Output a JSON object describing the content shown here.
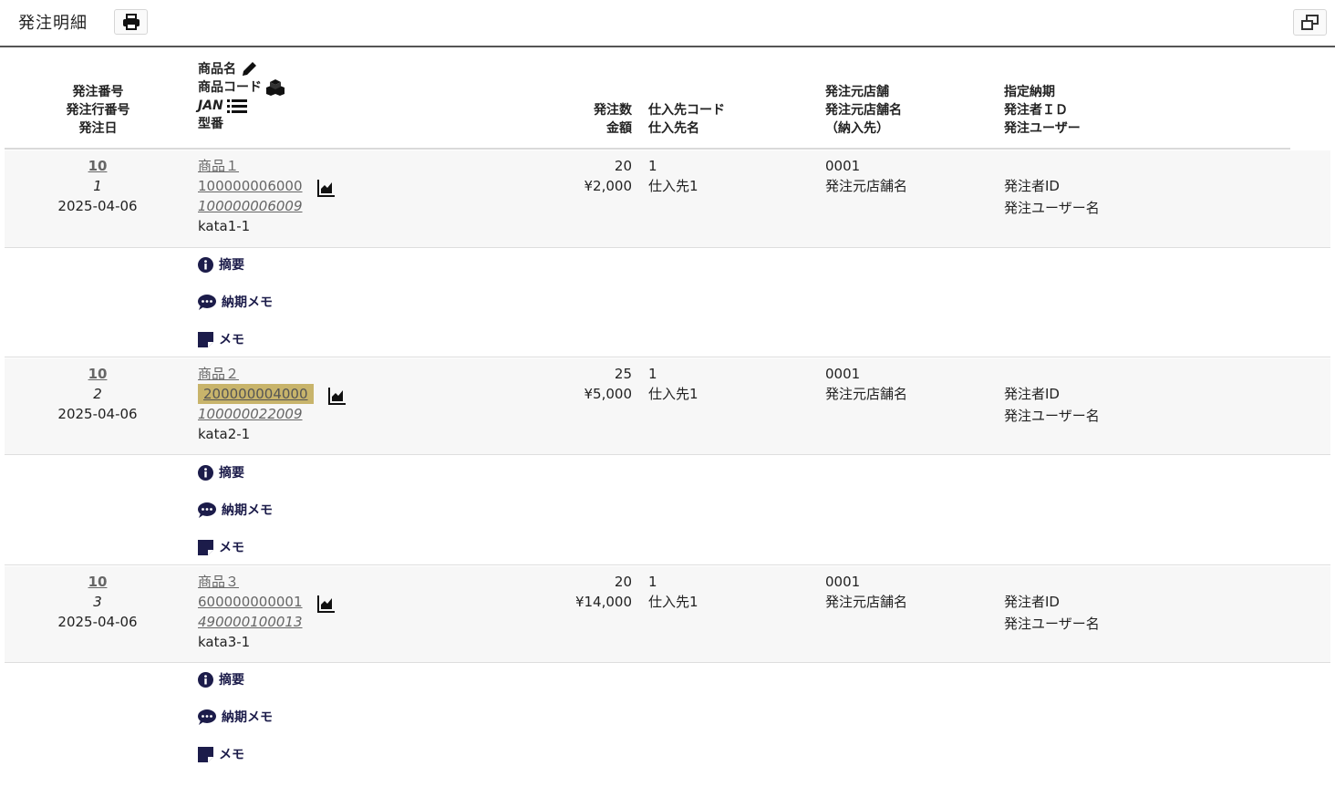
{
  "header": {
    "title": "発注明細"
  },
  "columns": {
    "order": [
      "発注番号",
      "発注行番号",
      "発注日"
    ],
    "product": [
      "商品名",
      "商品コード",
      "JAN",
      "型番"
    ],
    "qty": [
      "発注数",
      "金額"
    ],
    "supplier": [
      "仕入先コード",
      "仕入先名"
    ],
    "store": [
      "発注元店舗",
      "発注元店舗名",
      "（納入先）"
    ],
    "user": [
      "指定納期",
      "発注者ＩＤ",
      "発注ユーザー"
    ]
  },
  "rows": [
    {
      "order_no": "10",
      "line_no": "1",
      "date": "2025-04-06",
      "product_name": "商品１",
      "product_code": "100000006000",
      "jan": "100000006009",
      "model": "kata1-1",
      "qty": "20",
      "amount": "¥2,000",
      "supplier_code": "1",
      "supplier_name": "仕入先1",
      "store_code": "0001",
      "store_name": "発注元店舗名",
      "user_id": "発注者ID",
      "user_name": "発注ユーザー名"
    },
    {
      "order_no": "10",
      "line_no": "2",
      "date": "2025-04-06",
      "product_name": "商品２",
      "product_code": "200000004000",
      "jan": "100000022009",
      "model": "kata2-1",
      "qty": "25",
      "amount": "¥5,000",
      "supplier_code": "1",
      "supplier_name": "仕入先1",
      "store_code": "0001",
      "store_name": "発注元店舗名",
      "user_id": "発注者ID",
      "user_name": "発注ユーザー名"
    },
    {
      "order_no": "10",
      "line_no": "3",
      "date": "2025-04-06",
      "product_name": "商品３",
      "product_code": "600000000001",
      "jan": "490000100013",
      "model": "kata3-1",
      "qty": "20",
      "amount": "¥14,000",
      "supplier_code": "1",
      "supplier_name": "仕入先1",
      "store_code": "0001",
      "store_name": "発注元店舗名",
      "user_id": "発注者ID",
      "user_name": "発注ユーザー名"
    }
  ],
  "sub_labels": {
    "summary": "摘要",
    "delivery_memo": "納期メモ",
    "memo": "メモ"
  },
  "icons": {
    "print": "printer-icon",
    "expand": "window-restore-icon",
    "edit": "pencil-icon",
    "boxes": "cubes-icon",
    "list": "list-icon",
    "chart": "chart-icon",
    "info": "info-circle-icon",
    "comment": "comment-dots-icon",
    "note": "sticky-note-icon"
  },
  "colors": {
    "highlight": "#c8b46b",
    "row_bg": "#f7f7f7",
    "icon_navy": "#1c1c4a"
  }
}
